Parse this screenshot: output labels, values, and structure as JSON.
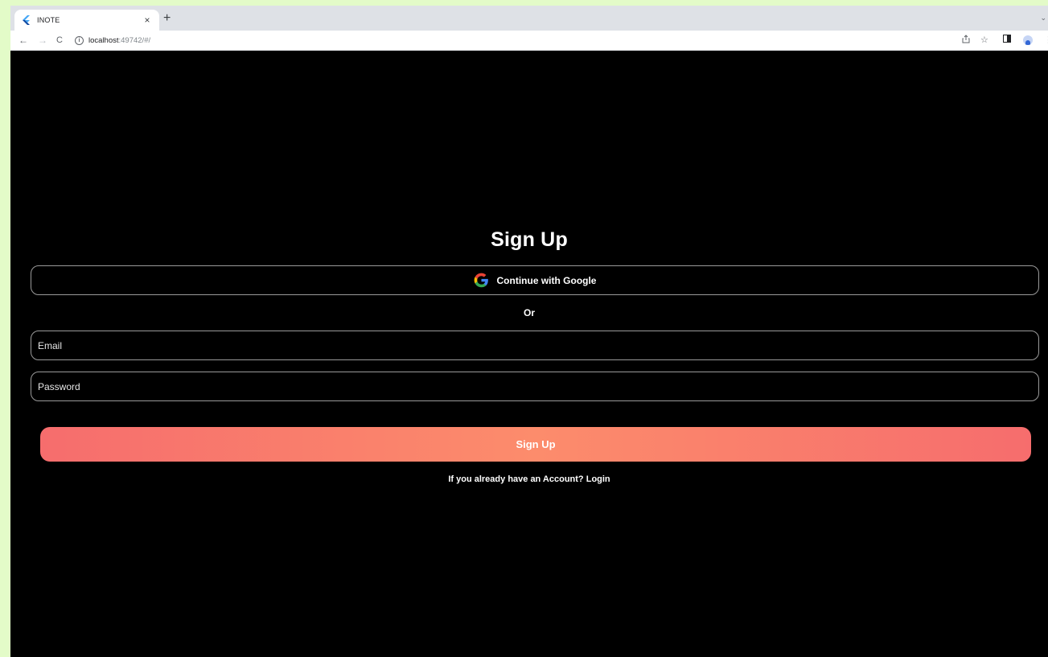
{
  "browser": {
    "tab_title": "INOTE",
    "tab_close": "×",
    "new_tab": "+",
    "tabstrip_menu": "⌄",
    "nav": {
      "back": "←",
      "forward": "→",
      "reload": "C"
    },
    "url_host": "localhost",
    "url_rest": ":49742/#/",
    "icons": [
      "share-icon",
      "star-icon",
      "side-panel-icon",
      "profile-icon",
      "menu-icon"
    ]
  },
  "page": {
    "title": "Sign Up",
    "google_button_label": "Continue with Google",
    "or_text": "Or",
    "email_placeholder": "Email",
    "password_placeholder": "Password",
    "signup_button_label": "Sign Up",
    "login_prompt": "If you already have an Account?",
    "login_link": "Login"
  },
  "colors": {
    "page_background": "#000000",
    "outer_background": "#e3fbc8",
    "button_gradient_edge": "#f66d6d",
    "button_gradient_center": "#fc8c6c",
    "field_border": "#9a9a9a"
  }
}
